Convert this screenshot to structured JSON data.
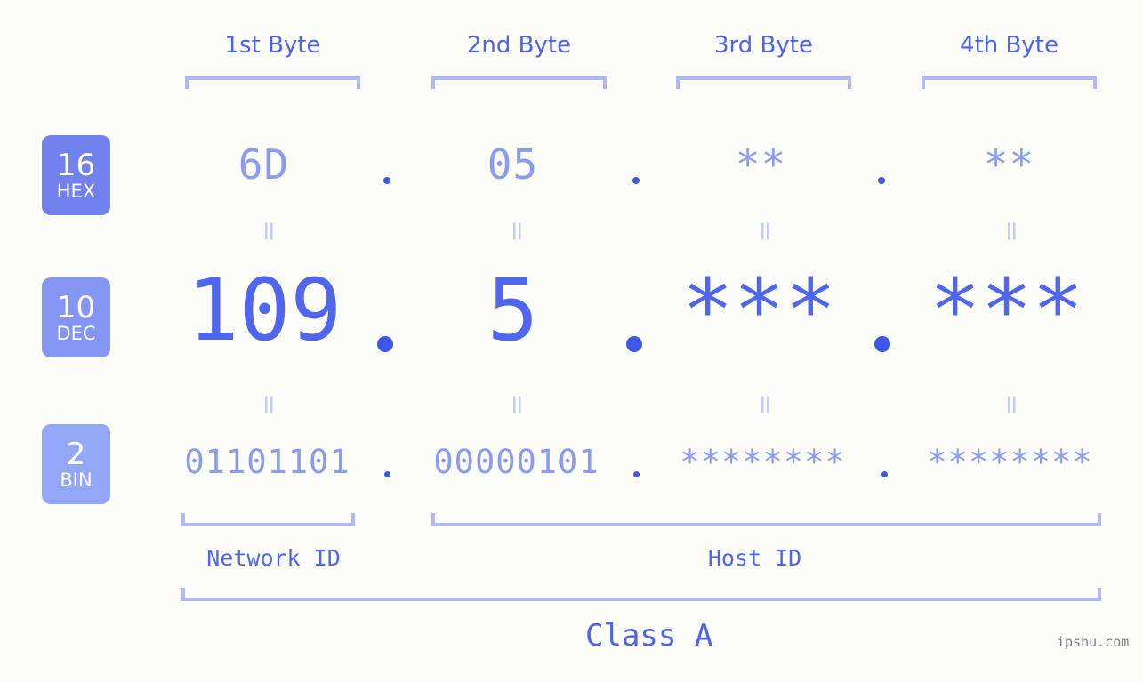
{
  "theme": {
    "background": "#fcfdf9",
    "accent_strong": "#4d62ef",
    "accent_mid": "#8c9bf2",
    "accent_light": "#aeb9f7",
    "badge_hex": "#7182ee",
    "badge_dec": "#8495f3",
    "badge_bin": "#93a6f8",
    "dot": "#3f57e8"
  },
  "byte_headers": [
    {
      "label": "1st Byte"
    },
    {
      "label": "2nd Byte"
    },
    {
      "label": "3rd Byte"
    },
    {
      "label": "4th Byte"
    }
  ],
  "bases": [
    {
      "num": "16",
      "abbr": "HEX"
    },
    {
      "num": "10",
      "abbr": "DEC"
    },
    {
      "num": "2",
      "abbr": "BIN"
    }
  ],
  "rows": {
    "hex": {
      "base_num": "16",
      "base_abbr": "HEX",
      "values": [
        "6D",
        "05",
        "**",
        "**"
      ]
    },
    "dec": {
      "base_num": "10",
      "base_abbr": "DEC",
      "values": [
        "109",
        "5",
        "***",
        "***"
      ]
    },
    "bin": {
      "base_num": "2",
      "base_abbr": "BIN",
      "values": [
        "01101101",
        "00000101",
        "********",
        "********"
      ]
    }
  },
  "separators": {
    "glyph": ".",
    "count_per_row": 3
  },
  "equals": {
    "glyph": "=",
    "rows": 2,
    "per_row": 4
  },
  "sections": [
    {
      "label": "Network ID"
    },
    {
      "label": "Host ID"
    }
  ],
  "class": {
    "label": "Class A"
  },
  "watermark": {
    "text": "ipshu.com"
  }
}
